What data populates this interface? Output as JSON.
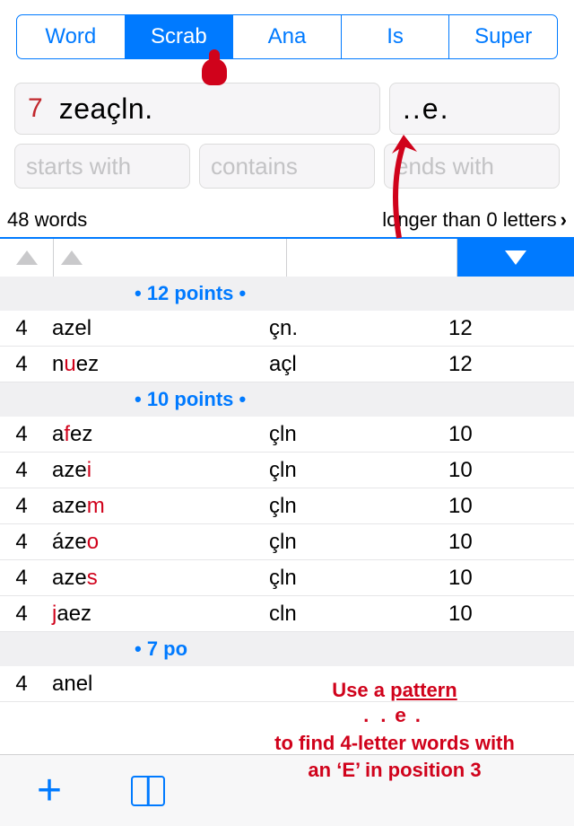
{
  "tabs": [
    "Word",
    "Scrab",
    "Ana",
    "Is",
    "Super"
  ],
  "active_tab_index": 1,
  "letters": {
    "count": "7",
    "value": "zeaçln."
  },
  "pattern": "..e.",
  "filters": {
    "starts": "starts with",
    "contains": "contains",
    "ends": "ends with"
  },
  "status": {
    "count": "48 words",
    "filter_label": "longer than 0 letters"
  },
  "groups": [
    {
      "label": "• 12 points •",
      "rows": [
        {
          "len": "4",
          "word_pre": "",
          "word_hl": "",
          "word_post": "azel",
          "rem": "çn.",
          "pts": "12"
        },
        {
          "len": "4",
          "word_pre": "n",
          "word_hl": "u",
          "word_post": "ez",
          "rem": "açl",
          "pts": "12"
        }
      ]
    },
    {
      "label": "• 10 points •",
      "rows": [
        {
          "len": "4",
          "word_pre": "a",
          "word_hl": "f",
          "word_post": "ez",
          "rem": "çln",
          "pts": "10"
        },
        {
          "len": "4",
          "word_pre": "aze",
          "word_hl": "i",
          "word_post": "",
          "rem": "çln",
          "pts": "10"
        },
        {
          "len": "4",
          "word_pre": "aze",
          "word_hl": "m",
          "word_post": "",
          "rem": "çln",
          "pts": "10"
        },
        {
          "len": "4",
          "word_pre": "áze",
          "word_hl": "o",
          "word_post": "",
          "rem": "çln",
          "pts": "10"
        },
        {
          "len": "4",
          "word_pre": "aze",
          "word_hl": "s",
          "word_post": "",
          "rem": "çln",
          "pts": "10"
        },
        {
          "len": "4",
          "word_pre": "",
          "word_hl": "j",
          "word_post": "aez",
          "rem": "cln",
          "pts": "10"
        }
      ]
    },
    {
      "label": "• 7 po",
      "rows": [
        {
          "len": "4",
          "word_pre": "",
          "word_hl": "",
          "word_post": "anel",
          "rem": "",
          "pts": ""
        }
      ]
    }
  ],
  "annotation": {
    "l1a": "Use a ",
    "l1b": "pattern",
    "l2": "..e.",
    "l3": "to find 4-letter words with",
    "l4": "an ‘E’ in position 3"
  }
}
